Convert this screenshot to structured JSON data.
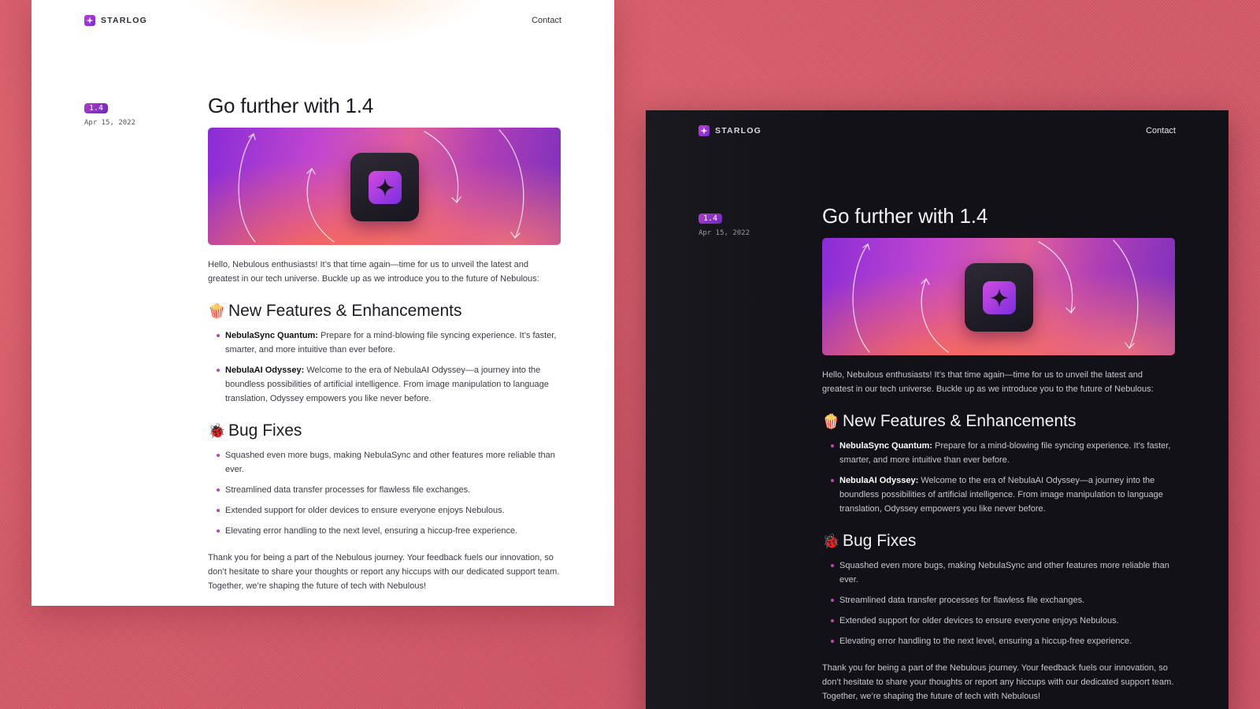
{
  "header": {
    "brand": "STARLOG",
    "contact": "Contact"
  },
  "release": {
    "version": "1.4",
    "date": "Apr 15, 2022",
    "title": "Go further with 1.4",
    "intro": "Hello, Nebulous enthusiasts! It’s that time again—time for us to unveil the latest and greatest in our tech universe. Buckle up as we introduce you to the future of Nebulous:",
    "features": {
      "emoji": "🍿",
      "heading": "New Features & Enhancements",
      "items": [
        {
          "name": "NebulaSync Quantum:",
          "text": " Prepare for a mind-blowing file syncing experience. It’s faster, smarter, and more intuitive than ever before."
        },
        {
          "name": "NebulaAI Odyssey:",
          "text": " Welcome to the era of NebulaAI Odyssey—a journey into the boundless possibilities of artificial intelligence. From image manipulation to language translation, Odyssey empowers you like never before."
        }
      ]
    },
    "bugfixes": {
      "emoji": "🐞",
      "heading": "Bug Fixes",
      "items": [
        "Squashed even more bugs, making NebulaSync and other features more reliable than ever.",
        "Streamlined data transfer processes for flawless file exchanges.",
        "Extended support for older devices to ensure everyone enjoys Nebulous.",
        "Elevating error handling to the next level, ensuring a hiccup-free experience."
      ]
    },
    "outro": "Thank you for being a part of the Nebulous journey. Your feedback fuels our innovation, so don’t hesitate to share your thoughts or report any hiccups with our dedicated support team. Together, we’re shaping the future of tech with Nebulous!"
  },
  "icons": {
    "brand_logo": "sparkle-icon",
    "hero_app": "sparkle-icon",
    "bullet": "dot"
  },
  "colors": {
    "background": "#d45a68",
    "accent": "#b03bd0",
    "dark_panel": "#111117",
    "light_panel": "#ffffff"
  }
}
